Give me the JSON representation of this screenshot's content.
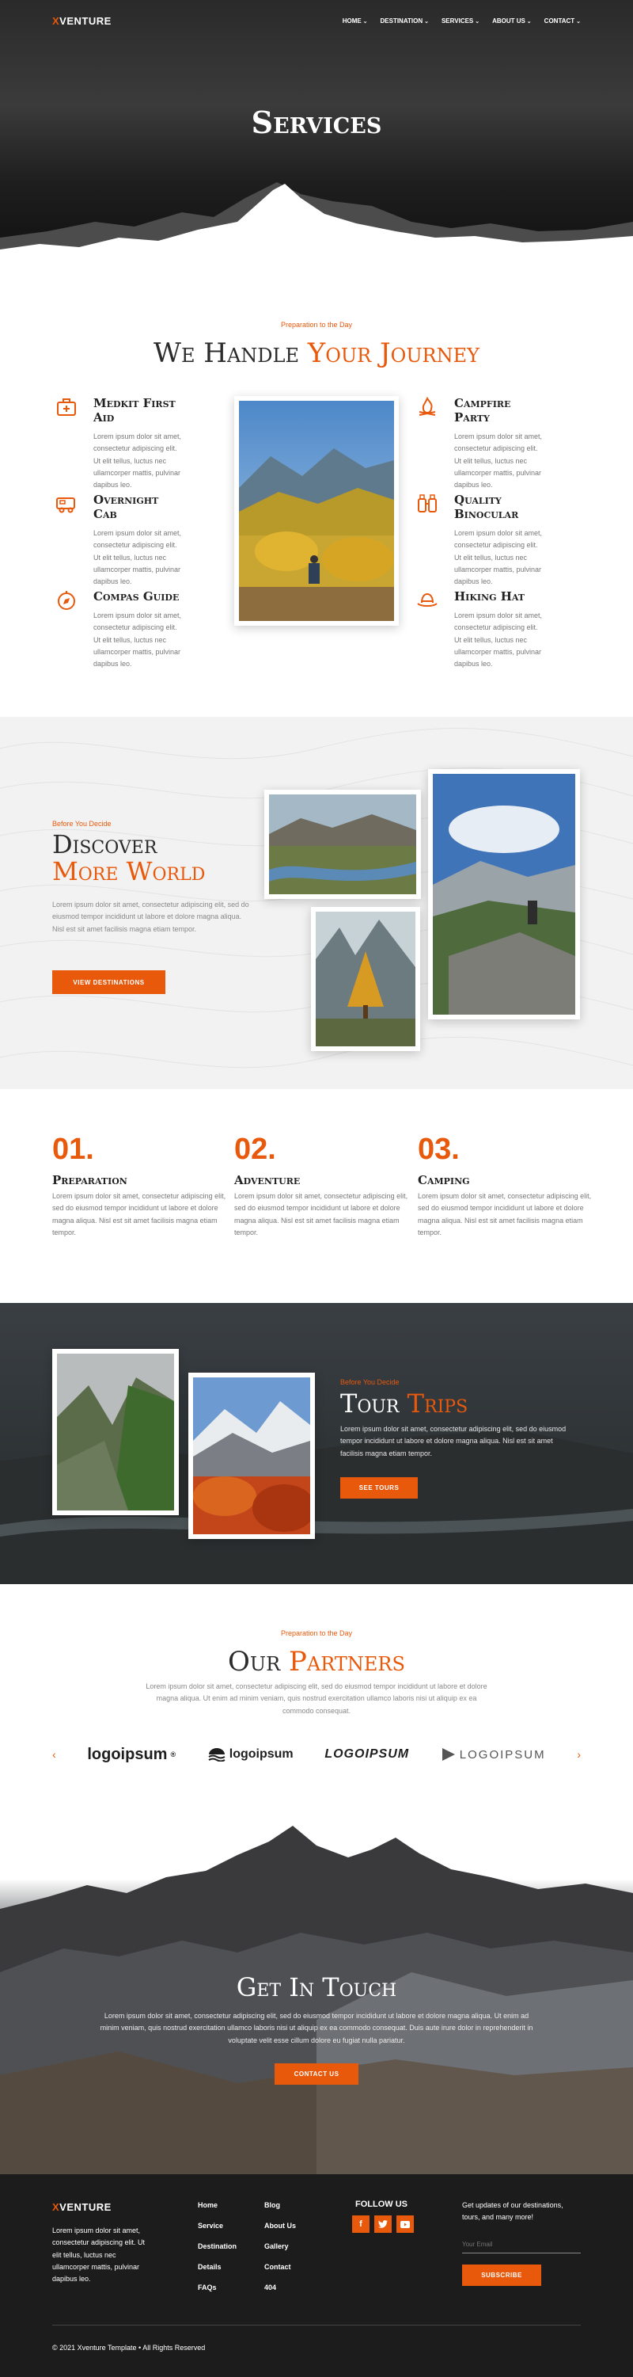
{
  "nav": {
    "logo_x": "X",
    "logo_rest": "VENTURE",
    "items": [
      {
        "label": "HOME"
      },
      {
        "label": "DESTINATION"
      },
      {
        "label": "SERVICES"
      },
      {
        "label": "ABOUT US"
      },
      {
        "label": "CONTACT"
      }
    ]
  },
  "hero": {
    "title": "Services"
  },
  "handle": {
    "eyebrow": "Preparation to the Day",
    "title_a": "We Handle ",
    "title_b": "Your Journey",
    "features": [
      {
        "title": "Medkit First Aid",
        "text": "Lorem ipsum dolor sit amet, consectetur adipiscing elit. Ut elit tellus, luctus nec ullamcorper mattis, pulvinar dapibus leo.",
        "icon": "first-aid-kit-icon"
      },
      {
        "title": "Overnight Cab",
        "text": "Lorem ipsum dolor sit amet, consectetur adipiscing elit. Ut elit tellus, luctus nec ullamcorper mattis, pulvinar dapibus leo.",
        "icon": "camper-van-icon"
      },
      {
        "title": "Compas Guide",
        "text": "Lorem ipsum dolor sit amet, consectetur adipiscing elit. Ut elit tellus, luctus nec ullamcorper mattis, pulvinar dapibus leo.",
        "icon": "compass-icon"
      },
      {
        "title": "Campfire Party",
        "text": "Lorem ipsum dolor sit amet, consectetur adipiscing elit. Ut elit tellus, luctus nec ullamcorper mattis, pulvinar dapibus leo.",
        "icon": "campfire-icon"
      },
      {
        "title": "Quality Binocular",
        "text": "Lorem ipsum dolor sit amet, consectetur adipiscing elit. Ut elit tellus, luctus nec ullamcorper mattis, pulvinar dapibus leo.",
        "icon": "binoculars-icon"
      },
      {
        "title": "Hiking Hat",
        "text": "Lorem ipsum dolor sit amet, consectetur adipiscing elit. Ut elit tellus, luctus nec ullamcorper mattis, pulvinar dapibus leo.",
        "icon": "hat-icon"
      }
    ]
  },
  "discover": {
    "eyebrow": "Before You Decide",
    "title_a": "Discover",
    "title_b": "More World",
    "text": "Lorem ipsum dolor sit amet, consectetur adipiscing elit, sed do eiusmod tempor incididunt ut labore et dolore magna aliqua. Nisl est sit amet facilisis magna etiam tempor.",
    "button": "VIEW DESTINATIONS"
  },
  "steps": [
    {
      "num": "01.",
      "title": "Preparation",
      "text": "Lorem ipsum dolor sit amet, consectetur adipiscing elit, sed do eiusmod tempor incididunt ut labore et dolore magna aliqua. Nisl est sit amet facilisis magna etiam tempor."
    },
    {
      "num": "02.",
      "title": "Adventure",
      "text": "Lorem ipsum dolor sit amet, consectetur adipiscing elit, sed do eiusmod tempor incididunt ut labore et dolore magna aliqua. Nisl est sit amet facilisis magna etiam tempor."
    },
    {
      "num": "03.",
      "title": "Camping",
      "text": "Lorem ipsum dolor sit amet, consectetur adipiscing elit, sed do eiusmod tempor incididunt ut labore et dolore magna aliqua. Nisl est sit amet facilisis magna etiam tempor."
    }
  ],
  "tour": {
    "eyebrow": "Before You Decide",
    "title_a": "Tour ",
    "title_b": "Trips",
    "text": "Lorem ipsum dolor sit amet, consectetur adipiscing elit, sed do eiusmod tempor incididunt ut labore et dolore magna aliqua. Nisl est sit amet facilisis magna etiam tempor.",
    "button": "SEE TOURS"
  },
  "partners": {
    "eyebrow": "Preparation to the Day",
    "title_a": "Our ",
    "title_b": "Partners",
    "text": "Lorem ipsum dolor sit amet, consectetur adipiscing elit, sed do eiusmod tempor incididunt ut labore et dolore magna aliqua. Ut enim ad minim veniam, quis nostrud exercitation ullamco laboris nisi ut aliquip ex ea commodo consequat.",
    "logos": [
      "logoipsum",
      "logoipsum",
      "LOGOIPSUM",
      "LOGOIPSUM"
    ]
  },
  "contact": {
    "title": "Get In Touch",
    "text": "Lorem ipsum dolor sit amet, consectetur adipiscing elit, sed do eiusmod tempor incididunt ut labore et dolore magna aliqua. Ut enim ad minim veniam, quis nostrud exercitation ullamco laboris nisi ut aliquip ex ea commodo consequat. Duis aute irure dolor in reprehenderit in voluptate velit esse cillum dolore eu fugiat nulla pariatur.",
    "button": "CONTACT US"
  },
  "footer": {
    "about": "Lorem ipsum dolor sit amet, consectetur adipiscing elit. Ut elit tellus, luctus nec ullamcorper mattis, pulvinar dapibus leo.",
    "col1": [
      "Home",
      "Service",
      "Destination",
      "Details",
      "FAQs"
    ],
    "col2": [
      "Blog",
      "About Us",
      "Gallery",
      "Contact",
      "404"
    ],
    "follow": "FOLLOW US",
    "newsletter_text": "Get updates of our destinations, tours, and many more!",
    "email_placeholder": "Your Email",
    "subscribe": "SUBSCRIBE",
    "copyright": "© 2021 Xventure Template • All Rights Reserved"
  },
  "colors": {
    "accent": "#e8590c",
    "dark": "#1c1c1c"
  }
}
